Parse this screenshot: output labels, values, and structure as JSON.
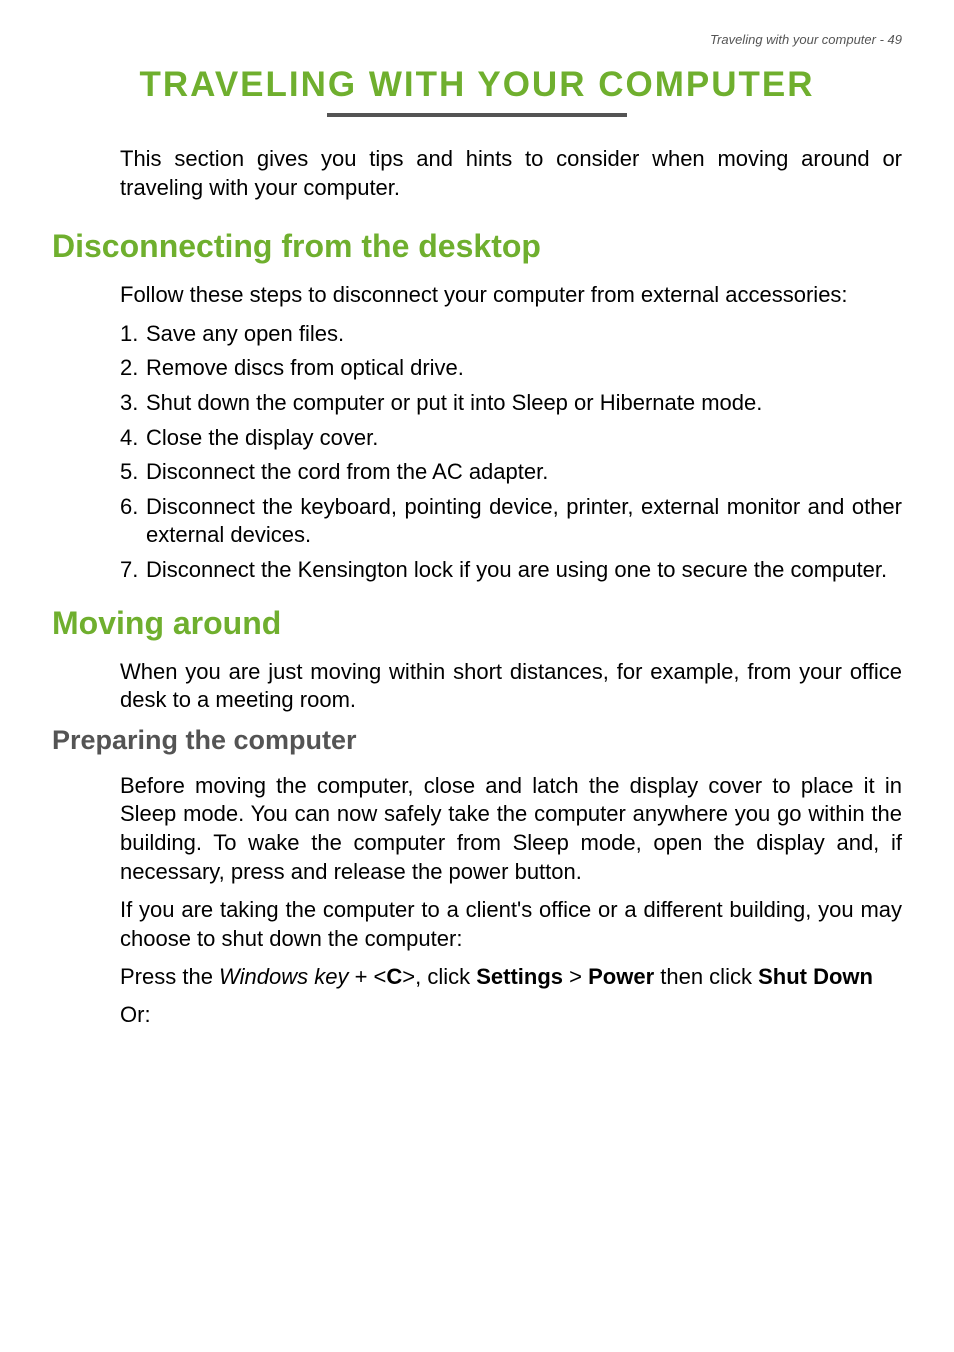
{
  "header": {
    "text": "Traveling with your computer - 49"
  },
  "title": "TRAVELING WITH YOUR COMPUTER",
  "intro": "This section gives you tips and hints to consider when moving around or traveling with your computer.",
  "section1": {
    "heading": "Disconnecting from the desktop",
    "intro": "Follow these steps to disconnect your computer from external accessories:",
    "items": [
      {
        "num": "1.",
        "text": "Save any open files."
      },
      {
        "num": "2.",
        "text": "Remove discs from optical drive."
      },
      {
        "num": "3.",
        "text": "Shut down the computer or put it into Sleep or Hibernate mode."
      },
      {
        "num": "4.",
        "text": "Close the display cover."
      },
      {
        "num": "5.",
        "text": "Disconnect the cord from the AC adapter."
      },
      {
        "num": "6.",
        "text": "Disconnect the keyboard, pointing device, printer, external monitor and other external devices."
      },
      {
        "num": "7.",
        "text": "Disconnect the Kensington lock if you are using one to secure the computer."
      }
    ]
  },
  "section2": {
    "heading": "Moving around",
    "intro": "When you are just moving within short distances, for example, from your office desk to a meeting room.",
    "subheading": "Preparing the computer",
    "para1": "Before moving the computer, close and latch the display cover to place it in Sleep mode. You can now safely take the computer anywhere you go within the building. To wake the computer from Sleep mode, open the display and, if necessary, press and release the power button.",
    "para2": "If you are taking the computer to a client's office or a different building, you may choose to shut down the computer:",
    "shortcut": {
      "prefix": "Press the ",
      "windows_key": "Windows key",
      "plus": " + <",
      "key_c": "C",
      "gt": ">, click ",
      "settings": "Settings",
      "gt2": " > ",
      "power": "Power",
      "then": " then click ",
      "shutdown": "Shut Down"
    },
    "or": "Or:"
  }
}
